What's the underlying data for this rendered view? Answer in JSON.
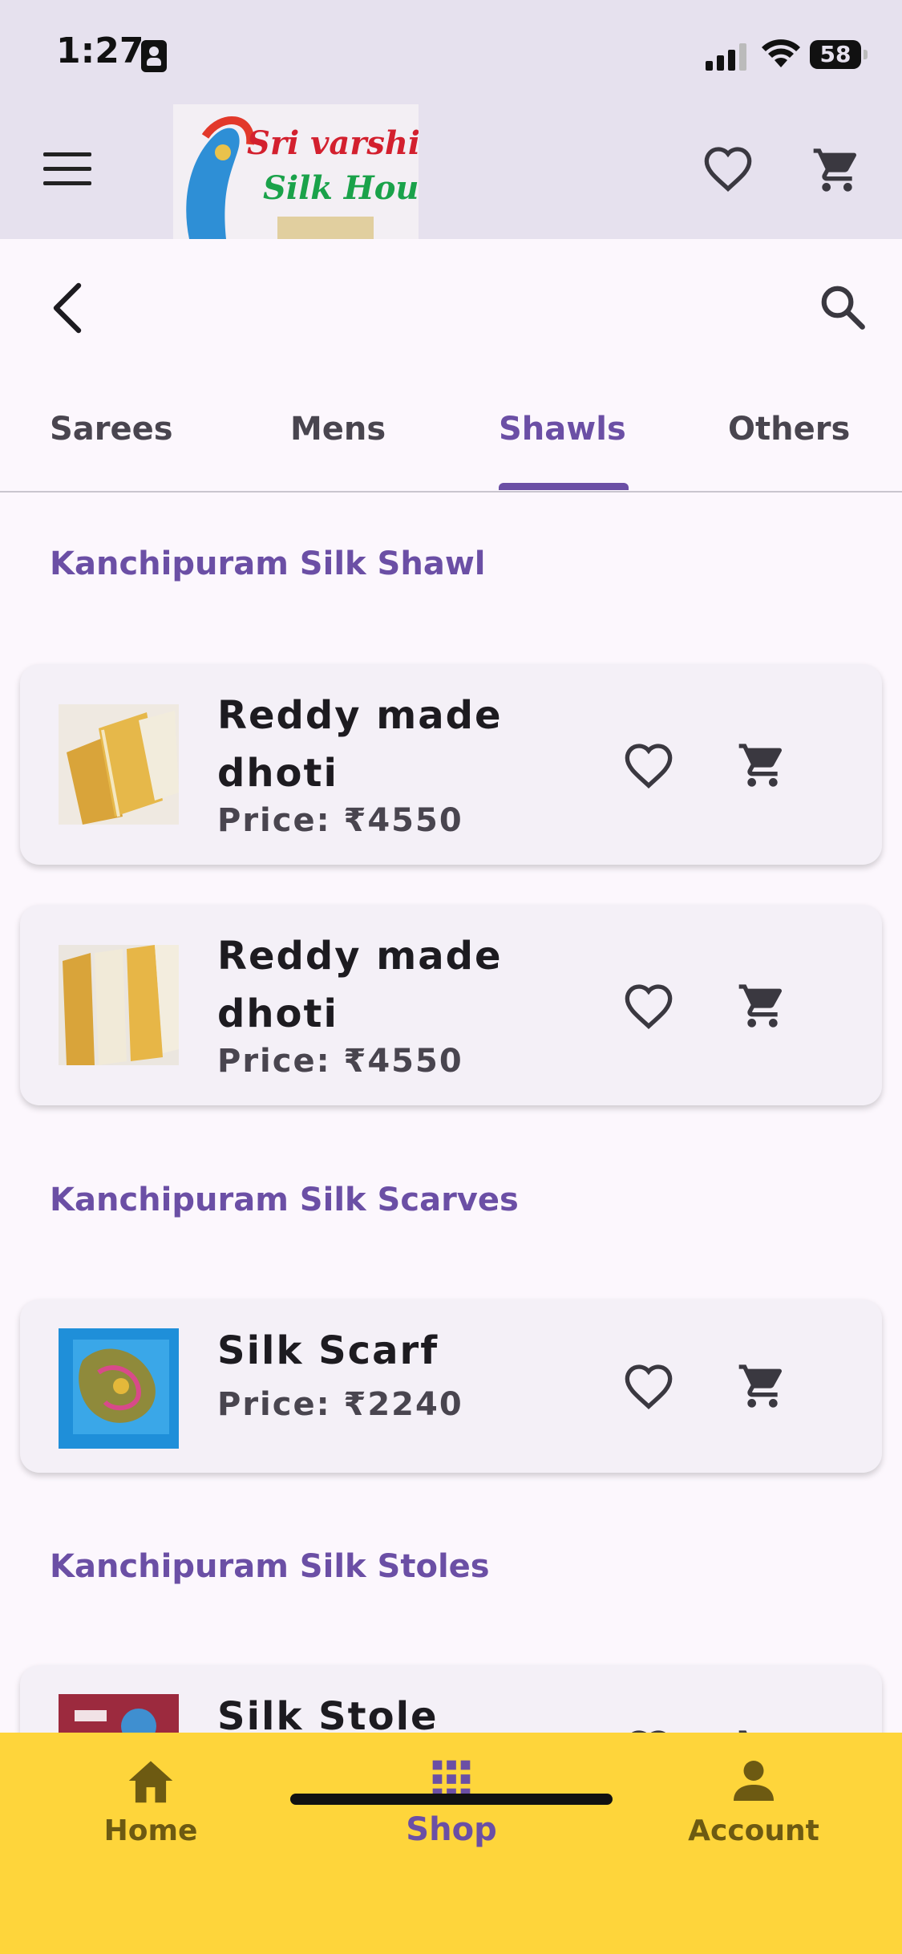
{
  "status_bar": {
    "time": "1:27",
    "battery": "58"
  },
  "header": {
    "logo_text_line1": "Sri varshini",
    "logo_text_line2": "Silk House"
  },
  "tabs": [
    {
      "label": "Sarees"
    },
    {
      "label": "Mens"
    },
    {
      "label": "Shawls"
    },
    {
      "label": "Others"
    }
  ],
  "active_tab": "Shawls",
  "sections": [
    {
      "title": "Kanchipuram Silk Shawl",
      "products": [
        {
          "name": "Reddy made dhoti",
          "price": "Price: ₹4550"
        },
        {
          "name": "Reddy made dhoti",
          "price": "Price: ₹4550"
        }
      ]
    },
    {
      "title": "Kanchipuram Silk Scarves",
      "products": [
        {
          "name": "Silk Scarf",
          "price": "Price: ₹2240"
        }
      ]
    },
    {
      "title": "Kanchipuram Silk Stoles",
      "products": [
        {
          "name": "Silk Stole",
          "price": ""
        }
      ]
    }
  ],
  "bottom_nav": {
    "home": "Home",
    "shop": "Shop",
    "account": "Account"
  },
  "colors": {
    "accent": "#6b4fa5",
    "header_bg": "#e6e1ee",
    "bottom_nav_bg": "#fed53b",
    "page_bg": "#fcf7fd"
  }
}
